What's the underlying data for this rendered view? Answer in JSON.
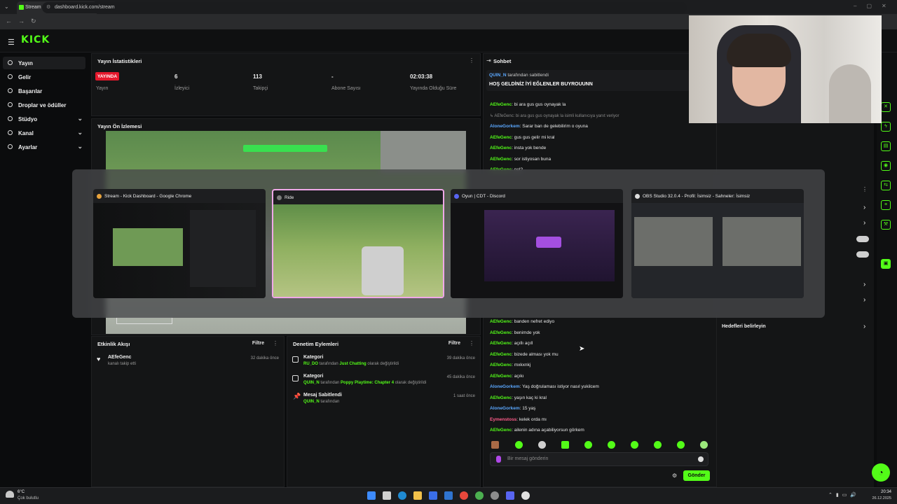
{
  "browser": {
    "tab_title": "Stream - Kick Dashboard",
    "url": "dashboard.kick.com/stream"
  },
  "brand": {
    "logo": "KICK",
    "accent": "#53fc18"
  },
  "sidebar": {
    "items": [
      {
        "label": "Yayın"
      },
      {
        "label": "Gelir"
      },
      {
        "label": "Başarılar"
      },
      {
        "label": "Droplar ve ödüller"
      },
      {
        "label": "Stüdyo"
      },
      {
        "label": "Kanal"
      },
      {
        "label": "Ayarlar"
      }
    ]
  },
  "stats": {
    "title": "Yayın İstatistikleri",
    "live_badge": "YAYINDA",
    "live_label": "Yayın",
    "viewers_value": "6",
    "viewers_label": "İzleyici",
    "followers_value": "113",
    "followers_label": "Takipçi",
    "subs_value": "-",
    "subs_label": "Abone Sayısı",
    "uptime_value": "02:03:38",
    "uptime_label": "Yayında Olduğu Süre"
  },
  "preview": {
    "title": "Yayın Ön İzlemesi"
  },
  "activity": {
    "title": "Etkinlik Akışı",
    "filter": "Filtre",
    "events": [
      {
        "user": "AEfeGenc",
        "text": "kanalı takip etti",
        "time": "32 dakika önce"
      }
    ]
  },
  "moderation": {
    "title": "Denetim Eylemleri",
    "filter": "Filtre",
    "actions": [
      {
        "title": "Kategori",
        "user": "RU_DO",
        "mid": "tarafından",
        "value": "Just Chatting",
        "tail": "olarak değiştirildi",
        "time": "39 dakika önce"
      },
      {
        "title": "Kategori",
        "user": "QUIN_N",
        "mid": "tarafından",
        "value": "Poppy Playtime: Chapter 4",
        "tail": "olarak değiştirildi",
        "time": "45 dakika önce"
      },
      {
        "title": "Mesaj Sabitlendi",
        "user": "QUIN_N",
        "mid": "tarafından",
        "value": "",
        "tail": "",
        "time": "1 saat önce"
      }
    ]
  },
  "chat": {
    "title": "Sohbet",
    "pinned_by_user": "QUIN_N",
    "pinned_by_text": "tarafından sabitlendi",
    "pinned_message": "HOŞ GELDİNİZ İYİ EĞLENLER BUYROUUNN",
    "messages_top": [
      {
        "user": "AEfeGenc",
        "text": "bi ara gus gus oynayak la",
        "color": "green"
      },
      {
        "user": "",
        "text": "↳ AEfeGenc: bi ara gus gus oynayak la isimli kullanıcıya yanıt veriyor",
        "color": "reply"
      },
      {
        "user": "AloneGorkem",
        "text": "Sarar ban de gelebilirim o oyuna",
        "color": "blue"
      },
      {
        "user": "AEfeGenc",
        "text": "gus gus gelir mi kral",
        "color": "green"
      },
      {
        "user": "AEfeGenc",
        "text": "insta yok bende",
        "color": "green"
      },
      {
        "user": "AEfeGenc",
        "text": "sor istiyosan buna",
        "color": "green"
      },
      {
        "user": "AEfeGenc",
        "text": "nel?",
        "color": "green"
      }
    ],
    "messages_bottom": [
      {
        "user": "AEfeGenc",
        "text": "banden nefret ediyo",
        "color": "green"
      },
      {
        "user": "AEfeGenc",
        "text": "benimde yok",
        "color": "green"
      },
      {
        "user": "AEfeGenc",
        "text": "açıllı açıll",
        "color": "green"
      },
      {
        "user": "AEfeGenc",
        "text": "bizede alması yok mu",
        "color": "green"
      },
      {
        "user": "AEfeGenc",
        "text": "mxkxnkj",
        "color": "green"
      },
      {
        "user": "AEfeGenc",
        "text": "açıkı",
        "color": "green"
      },
      {
        "user": "AloneGorkem",
        "text": "Yaş doğrulaması istiyor nasıl yukilcem",
        "color": "blue"
      },
      {
        "user": "AEfeGenc",
        "text": "yaşın kaç ki kral",
        "color": "green"
      },
      {
        "user": "AloneGorkem",
        "text": "15 yaş",
        "color": "blue"
      },
      {
        "user": "Eymenstoss",
        "text": "kelek orda mı",
        "color": "pink"
      },
      {
        "user": "AEfeGenc",
        "text": "ailenin adına açabiliyorsun görkem",
        "color": "green"
      }
    ],
    "input_placeholder": "Bir mesaj gönderin",
    "send": "Gönder"
  },
  "right_panel": {
    "goals": "Hedefleri belirleyin"
  },
  "switcher": {
    "windows": [
      {
        "title": "Stream - Kick Dashboard - Google Chrome",
        "icon": "chrome-icon"
      },
      {
        "title": "Ride",
        "icon": "ride-icon"
      },
      {
        "title": "Oyun | CDT - Discord",
        "icon": "discord-icon"
      },
      {
        "title": "OBS Studio 32.0.4 - Profil: İsimsiz - Sahneler: İsimsiz",
        "icon": "obs-icon"
      }
    ]
  },
  "taskbar": {
    "weather_temp": "6°C",
    "weather_text": "Çok bulutlu",
    "time": "20:34",
    "date": "26.12.2025"
  }
}
